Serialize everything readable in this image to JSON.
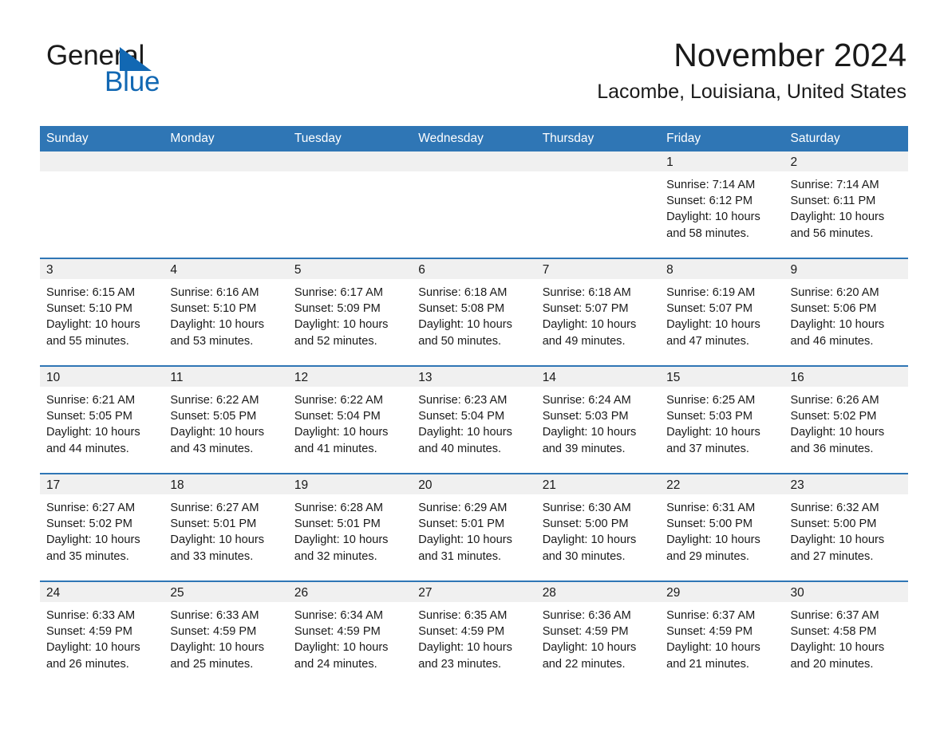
{
  "brand": {
    "name_part1": "General",
    "name_part2": "Blue",
    "logo_icon": "triangle-flag-icon",
    "accent_color": "#1268b3"
  },
  "header": {
    "month_title": "November 2024",
    "location": "Lacombe, Louisiana, United States"
  },
  "theme": {
    "header_blue": "#2f76b5",
    "daynum_band": "#f0f0f0",
    "text": "#1a1a1a"
  },
  "calendar": {
    "weekday_headers": [
      "Sunday",
      "Monday",
      "Tuesday",
      "Wednesday",
      "Thursday",
      "Friday",
      "Saturday"
    ],
    "weeks": [
      [
        {
          "day": "",
          "empty": true,
          "sunrise": "",
          "sunset": "",
          "daylight_line1": "",
          "daylight_line2": ""
        },
        {
          "day": "",
          "empty": true,
          "sunrise": "",
          "sunset": "",
          "daylight_line1": "",
          "daylight_line2": ""
        },
        {
          "day": "",
          "empty": true,
          "sunrise": "",
          "sunset": "",
          "daylight_line1": "",
          "daylight_line2": ""
        },
        {
          "day": "",
          "empty": true,
          "sunrise": "",
          "sunset": "",
          "daylight_line1": "",
          "daylight_line2": ""
        },
        {
          "day": "",
          "empty": true,
          "sunrise": "",
          "sunset": "",
          "daylight_line1": "",
          "daylight_line2": ""
        },
        {
          "day": "1",
          "empty": false,
          "sunrise": "Sunrise: 7:14 AM",
          "sunset": "Sunset: 6:12 PM",
          "daylight_line1": "Daylight: 10 hours",
          "daylight_line2": "and 58 minutes."
        },
        {
          "day": "2",
          "empty": false,
          "sunrise": "Sunrise: 7:14 AM",
          "sunset": "Sunset: 6:11 PM",
          "daylight_line1": "Daylight: 10 hours",
          "daylight_line2": "and 56 minutes."
        }
      ],
      [
        {
          "day": "3",
          "empty": false,
          "sunrise": "Sunrise: 6:15 AM",
          "sunset": "Sunset: 5:10 PM",
          "daylight_line1": "Daylight: 10 hours",
          "daylight_line2": "and 55 minutes."
        },
        {
          "day": "4",
          "empty": false,
          "sunrise": "Sunrise: 6:16 AM",
          "sunset": "Sunset: 5:10 PM",
          "daylight_line1": "Daylight: 10 hours",
          "daylight_line2": "and 53 minutes."
        },
        {
          "day": "5",
          "empty": false,
          "sunrise": "Sunrise: 6:17 AM",
          "sunset": "Sunset: 5:09 PM",
          "daylight_line1": "Daylight: 10 hours",
          "daylight_line2": "and 52 minutes."
        },
        {
          "day": "6",
          "empty": false,
          "sunrise": "Sunrise: 6:18 AM",
          "sunset": "Sunset: 5:08 PM",
          "daylight_line1": "Daylight: 10 hours",
          "daylight_line2": "and 50 minutes."
        },
        {
          "day": "7",
          "empty": false,
          "sunrise": "Sunrise: 6:18 AM",
          "sunset": "Sunset: 5:07 PM",
          "daylight_line1": "Daylight: 10 hours",
          "daylight_line2": "and 49 minutes."
        },
        {
          "day": "8",
          "empty": false,
          "sunrise": "Sunrise: 6:19 AM",
          "sunset": "Sunset: 5:07 PM",
          "daylight_line1": "Daylight: 10 hours",
          "daylight_line2": "and 47 minutes."
        },
        {
          "day": "9",
          "empty": false,
          "sunrise": "Sunrise: 6:20 AM",
          "sunset": "Sunset: 5:06 PM",
          "daylight_line1": "Daylight: 10 hours",
          "daylight_line2": "and 46 minutes."
        }
      ],
      [
        {
          "day": "10",
          "empty": false,
          "sunrise": "Sunrise: 6:21 AM",
          "sunset": "Sunset: 5:05 PM",
          "daylight_line1": "Daylight: 10 hours",
          "daylight_line2": "and 44 minutes."
        },
        {
          "day": "11",
          "empty": false,
          "sunrise": "Sunrise: 6:22 AM",
          "sunset": "Sunset: 5:05 PM",
          "daylight_line1": "Daylight: 10 hours",
          "daylight_line2": "and 43 minutes."
        },
        {
          "day": "12",
          "empty": false,
          "sunrise": "Sunrise: 6:22 AM",
          "sunset": "Sunset: 5:04 PM",
          "daylight_line1": "Daylight: 10 hours",
          "daylight_line2": "and 41 minutes."
        },
        {
          "day": "13",
          "empty": false,
          "sunrise": "Sunrise: 6:23 AM",
          "sunset": "Sunset: 5:04 PM",
          "daylight_line1": "Daylight: 10 hours",
          "daylight_line2": "and 40 minutes."
        },
        {
          "day": "14",
          "empty": false,
          "sunrise": "Sunrise: 6:24 AM",
          "sunset": "Sunset: 5:03 PM",
          "daylight_line1": "Daylight: 10 hours",
          "daylight_line2": "and 39 minutes."
        },
        {
          "day": "15",
          "empty": false,
          "sunrise": "Sunrise: 6:25 AM",
          "sunset": "Sunset: 5:03 PM",
          "daylight_line1": "Daylight: 10 hours",
          "daylight_line2": "and 37 minutes."
        },
        {
          "day": "16",
          "empty": false,
          "sunrise": "Sunrise: 6:26 AM",
          "sunset": "Sunset: 5:02 PM",
          "daylight_line1": "Daylight: 10 hours",
          "daylight_line2": "and 36 minutes."
        }
      ],
      [
        {
          "day": "17",
          "empty": false,
          "sunrise": "Sunrise: 6:27 AM",
          "sunset": "Sunset: 5:02 PM",
          "daylight_line1": "Daylight: 10 hours",
          "daylight_line2": "and 35 minutes."
        },
        {
          "day": "18",
          "empty": false,
          "sunrise": "Sunrise: 6:27 AM",
          "sunset": "Sunset: 5:01 PM",
          "daylight_line1": "Daylight: 10 hours",
          "daylight_line2": "and 33 minutes."
        },
        {
          "day": "19",
          "empty": false,
          "sunrise": "Sunrise: 6:28 AM",
          "sunset": "Sunset: 5:01 PM",
          "daylight_line1": "Daylight: 10 hours",
          "daylight_line2": "and 32 minutes."
        },
        {
          "day": "20",
          "empty": false,
          "sunrise": "Sunrise: 6:29 AM",
          "sunset": "Sunset: 5:01 PM",
          "daylight_line1": "Daylight: 10 hours",
          "daylight_line2": "and 31 minutes."
        },
        {
          "day": "21",
          "empty": false,
          "sunrise": "Sunrise: 6:30 AM",
          "sunset": "Sunset: 5:00 PM",
          "daylight_line1": "Daylight: 10 hours",
          "daylight_line2": "and 30 minutes."
        },
        {
          "day": "22",
          "empty": false,
          "sunrise": "Sunrise: 6:31 AM",
          "sunset": "Sunset: 5:00 PM",
          "daylight_line1": "Daylight: 10 hours",
          "daylight_line2": "and 29 minutes."
        },
        {
          "day": "23",
          "empty": false,
          "sunrise": "Sunrise: 6:32 AM",
          "sunset": "Sunset: 5:00 PM",
          "daylight_line1": "Daylight: 10 hours",
          "daylight_line2": "and 27 minutes."
        }
      ],
      [
        {
          "day": "24",
          "empty": false,
          "sunrise": "Sunrise: 6:33 AM",
          "sunset": "Sunset: 4:59 PM",
          "daylight_line1": "Daylight: 10 hours",
          "daylight_line2": "and 26 minutes."
        },
        {
          "day": "25",
          "empty": false,
          "sunrise": "Sunrise: 6:33 AM",
          "sunset": "Sunset: 4:59 PM",
          "daylight_line1": "Daylight: 10 hours",
          "daylight_line2": "and 25 minutes."
        },
        {
          "day": "26",
          "empty": false,
          "sunrise": "Sunrise: 6:34 AM",
          "sunset": "Sunset: 4:59 PM",
          "daylight_line1": "Daylight: 10 hours",
          "daylight_line2": "and 24 minutes."
        },
        {
          "day": "27",
          "empty": false,
          "sunrise": "Sunrise: 6:35 AM",
          "sunset": "Sunset: 4:59 PM",
          "daylight_line1": "Daylight: 10 hours",
          "daylight_line2": "and 23 minutes."
        },
        {
          "day": "28",
          "empty": false,
          "sunrise": "Sunrise: 6:36 AM",
          "sunset": "Sunset: 4:59 PM",
          "daylight_line1": "Daylight: 10 hours",
          "daylight_line2": "and 22 minutes."
        },
        {
          "day": "29",
          "empty": false,
          "sunrise": "Sunrise: 6:37 AM",
          "sunset": "Sunset: 4:59 PM",
          "daylight_line1": "Daylight: 10 hours",
          "daylight_line2": "and 21 minutes."
        },
        {
          "day": "30",
          "empty": false,
          "sunrise": "Sunrise: 6:37 AM",
          "sunset": "Sunset: 4:58 PM",
          "daylight_line1": "Daylight: 10 hours",
          "daylight_line2": "and 20 minutes."
        }
      ]
    ]
  }
}
